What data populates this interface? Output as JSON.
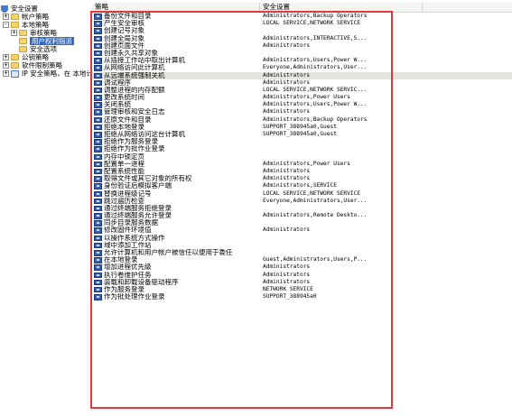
{
  "tree": {
    "items": [
      {
        "label": "安全设置",
        "icon": "shield-icon",
        "expander": "-"
      },
      {
        "label": "帐户策略",
        "icon": "folder-icon",
        "expander": "+"
      },
      {
        "label": "本地策略",
        "icon": "folder-icon",
        "expander": "-"
      },
      {
        "label": "审核策略",
        "icon": "folder-icon",
        "expander": "+"
      },
      {
        "label": "用户权利指派",
        "icon": "folder-icon",
        "expander": ""
      },
      {
        "label": "安全选项",
        "icon": "folder-icon",
        "expander": ""
      },
      {
        "label": "公钥策略",
        "icon": "folder-icon",
        "expander": "+"
      },
      {
        "label": "软件限制策略",
        "icon": "folder-icon",
        "expander": "+"
      },
      {
        "label": "IP 安全策略，在 本地计算机",
        "icon": "computer-icon",
        "expander": "+"
      }
    ]
  },
  "list": {
    "columns": {
      "policy": "策略",
      "setting": "安全设置"
    },
    "rows": [
      {
        "policy": "备份文件和目录",
        "setting": "Administrators,Backup Operators"
      },
      {
        "policy": "产生安全审核",
        "setting": "LOCAL SERVICE,NETWORK SERVICE"
      },
      {
        "policy": "创建记号对象",
        "setting": ""
      },
      {
        "policy": "创建全局对象",
        "setting": "Administrators,INTERACTIVE,S..."
      },
      {
        "policy": "创建页面文件",
        "setting": "Administrators"
      },
      {
        "policy": "创建永久共享对象",
        "setting": ""
      },
      {
        "policy": "从插接工作站中取出计算机",
        "setting": "Administrators,Users,Power W..."
      },
      {
        "policy": "从网络访问此计算机",
        "setting": "Everyone,Administrators,User..."
      },
      {
        "policy": "从远端系统强制关机",
        "setting": "Administrators"
      },
      {
        "policy": "调试程序",
        "setting": "Administrators"
      },
      {
        "policy": "调整进程的内存配额",
        "setting": "LOCAL SERVICE,NETWORK SERVIC..."
      },
      {
        "policy": "更改系统时间",
        "setting": "Administrators,Power Users"
      },
      {
        "policy": "关闭系统",
        "setting": "Administrators,Users,Power W..."
      },
      {
        "policy": "管理审核和安全日志",
        "setting": "Administrators"
      },
      {
        "policy": "还原文件和目录",
        "setting": "Administrators,Backup Operators"
      },
      {
        "policy": "拒绝本地登录",
        "setting": "SUPPORT_388945a0,Guest"
      },
      {
        "policy": "拒绝从网络访问这台计算机",
        "setting": "SUPPORT_388945a0,Guest"
      },
      {
        "policy": "拒绝作为服务登录",
        "setting": ""
      },
      {
        "policy": "拒绝作为批作业登录",
        "setting": ""
      },
      {
        "policy": "内存中锁定页",
        "setting": ""
      },
      {
        "policy": "配置单一进程",
        "setting": "Administrators,Power Users"
      },
      {
        "policy": "配置系统性能",
        "setting": "Administrators"
      },
      {
        "policy": "取得文件或其它对象的所有权",
        "setting": "Administrators"
      },
      {
        "policy": "身份验证后模拟客户端",
        "setting": "Administrators,SERVICE"
      },
      {
        "policy": "替换进程级记号",
        "setting": "LOCAL SERVICE,NETWORK SERVICE"
      },
      {
        "policy": "跳过遍历检查",
        "setting": "Everyone,Administrators,User..."
      },
      {
        "policy": "通过终端服务拒绝登录",
        "setting": ""
      },
      {
        "policy": "通过终端服务允许登录",
        "setting": "Administrators,Remote Deskto..."
      },
      {
        "policy": "同步目录服务数据",
        "setting": ""
      },
      {
        "policy": "修改固件环境值",
        "setting": "Administrators"
      },
      {
        "policy": "以操作系统方式操作",
        "setting": ""
      },
      {
        "policy": "域中添加工作站",
        "setting": ""
      },
      {
        "policy": "允许计算机和用户帐户被信任以便用于委任",
        "setting": ""
      },
      {
        "policy": "在本地登录",
        "setting": "Guest,Administrators,Users,P..."
      },
      {
        "policy": "增加进程优先级",
        "setting": "Administrators"
      },
      {
        "policy": "执行卷维护任务",
        "setting": "Administrators"
      },
      {
        "policy": "装载和卸载设备驱动程序",
        "setting": "Administrators"
      },
      {
        "policy": "作为服务登录",
        "setting": "NETWORK SERVICE"
      },
      {
        "policy": "作为批处理作业登录",
        "setting": "SUPPORT_388945a0"
      }
    ]
  },
  "colors": {
    "highlight_box": "#e0393e",
    "selected_bg": "#316ac5",
    "row_highlight": "#e6e6e0"
  }
}
